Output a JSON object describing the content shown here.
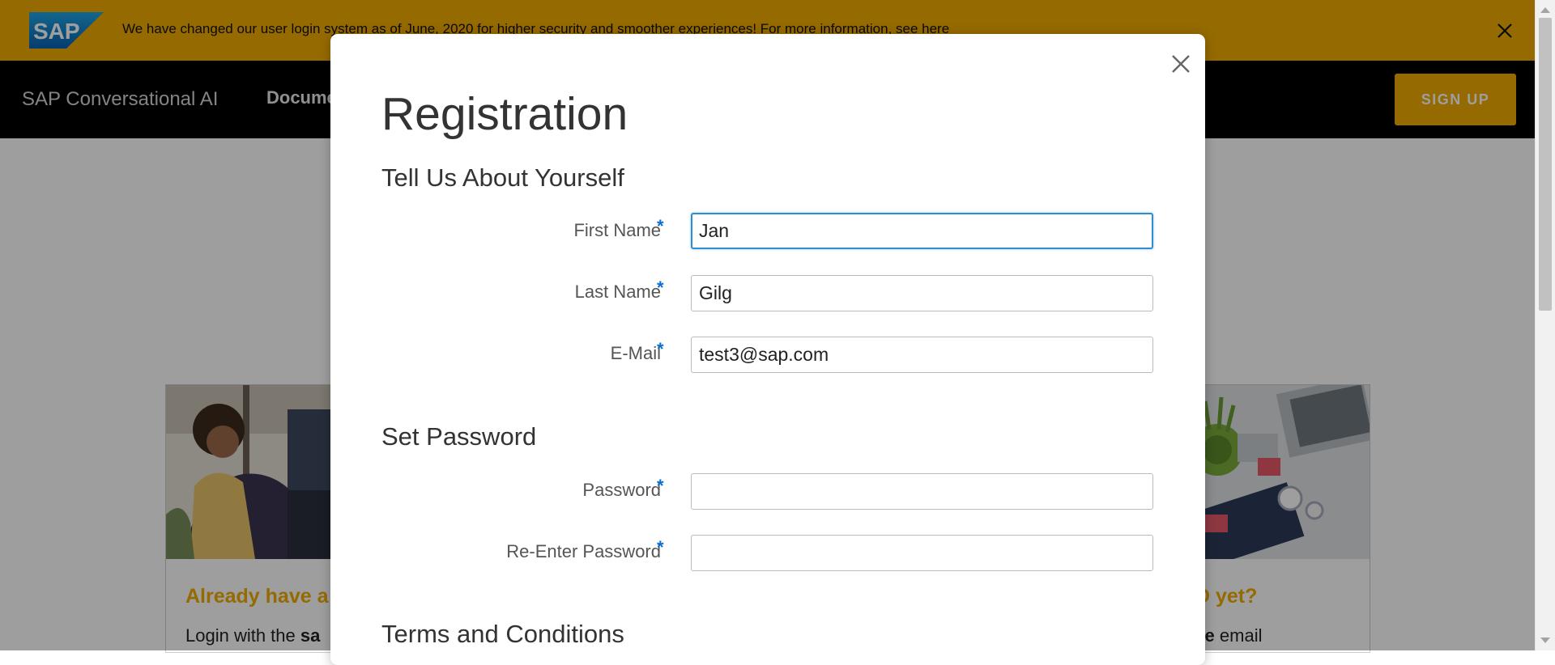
{
  "banner": {
    "logo_text": "SAP",
    "message": "We have changed our user login system as of June, 2020 for higher security and smoother experiences! For more information, see here",
    "close_icon": "close-icon",
    "color": "#f0ab00"
  },
  "nav": {
    "brand": "SAP Conversational AI",
    "documentation_label": "Docume",
    "signup_label": "SIGN UP"
  },
  "cards": {
    "left": {
      "title": "Already have a",
      "body_start": "Login with the ",
      "body_bold": "sa"
    },
    "right": {
      "title": "ID yet?",
      "body_bold": "me",
      "body_end": " email"
    }
  },
  "modal": {
    "title": "Registration",
    "close_icon": "close-icon",
    "section_about": "Tell Us About Yourself",
    "section_password": "Set Password",
    "section_terms": "Terms and Conditions",
    "fields": {
      "first_name": {
        "label": "First Name",
        "value": "Jan"
      },
      "last_name": {
        "label": "Last Name",
        "value": "Gilg"
      },
      "email": {
        "label": "E-Mail",
        "value": "test3@sap.com"
      },
      "password": {
        "label": "Password",
        "value": ""
      },
      "reenter_password": {
        "label": "Re-Enter Password",
        "value": ""
      }
    },
    "required_marker": "*",
    "accent_color": "#0a6ed1"
  }
}
